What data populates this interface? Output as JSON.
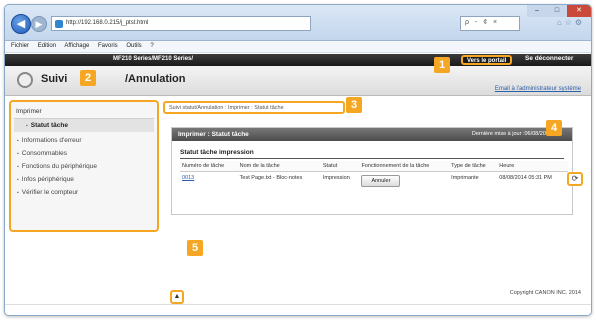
{
  "browser": {
    "url": "http://192.168.0.215/j_ptst.html",
    "tools": "ρ - ¢ ×",
    "menu": [
      "Fichier",
      "Edition",
      "Affichage",
      "Favoris",
      "Outils",
      "?"
    ]
  },
  "header": {
    "device": "MF210 Series/MF210 Series/",
    "title_part1": "Suivi",
    "title_part2": "/Annulation",
    "portal_link": "Vers le portail",
    "logout_link": "Se déconnecter",
    "mail_link": "Email à l'administrateur système"
  },
  "sidebar": {
    "heading": "Imprimer",
    "active": "Statut tâche",
    "items": [
      "Informations d'erreur",
      "Consommables",
      "Fonctions du périphérique",
      "Infos périphérique",
      "Vérifier le compteur"
    ]
  },
  "breadcrumb": "Suivi statut/Annulation : Imprimer : Statut tâche",
  "content": {
    "bar_title": "Imprimer : Statut tâche",
    "last_update": "Dernière mise à jour :06/08/2014",
    "section_title": "Statut tâche impression",
    "columns": [
      "Numéro de tâche",
      "Nom de la tâche",
      "Statut",
      "Fonctionnement de la tâche",
      "Type de tâche",
      "Heure"
    ],
    "row": {
      "job_number": "0013",
      "job_name": "Test Page.txt - Bloc-notes",
      "status": "Impression",
      "action": "Annuler",
      "type": "Imprimante",
      "time": "08/08/2014 05:31 PM"
    }
  },
  "footer": {
    "copyright": "Copyright CANON INC. 2014"
  },
  "callouts": [
    "1",
    "2",
    "3",
    "4",
    "5"
  ],
  "colors": {
    "callout": "#f5a623",
    "header_dark": "#1a1a1a",
    "link": "#2b5ea8"
  },
  "icons": {
    "refresh": "refresh-icon",
    "top": "back-to-top-icon"
  }
}
